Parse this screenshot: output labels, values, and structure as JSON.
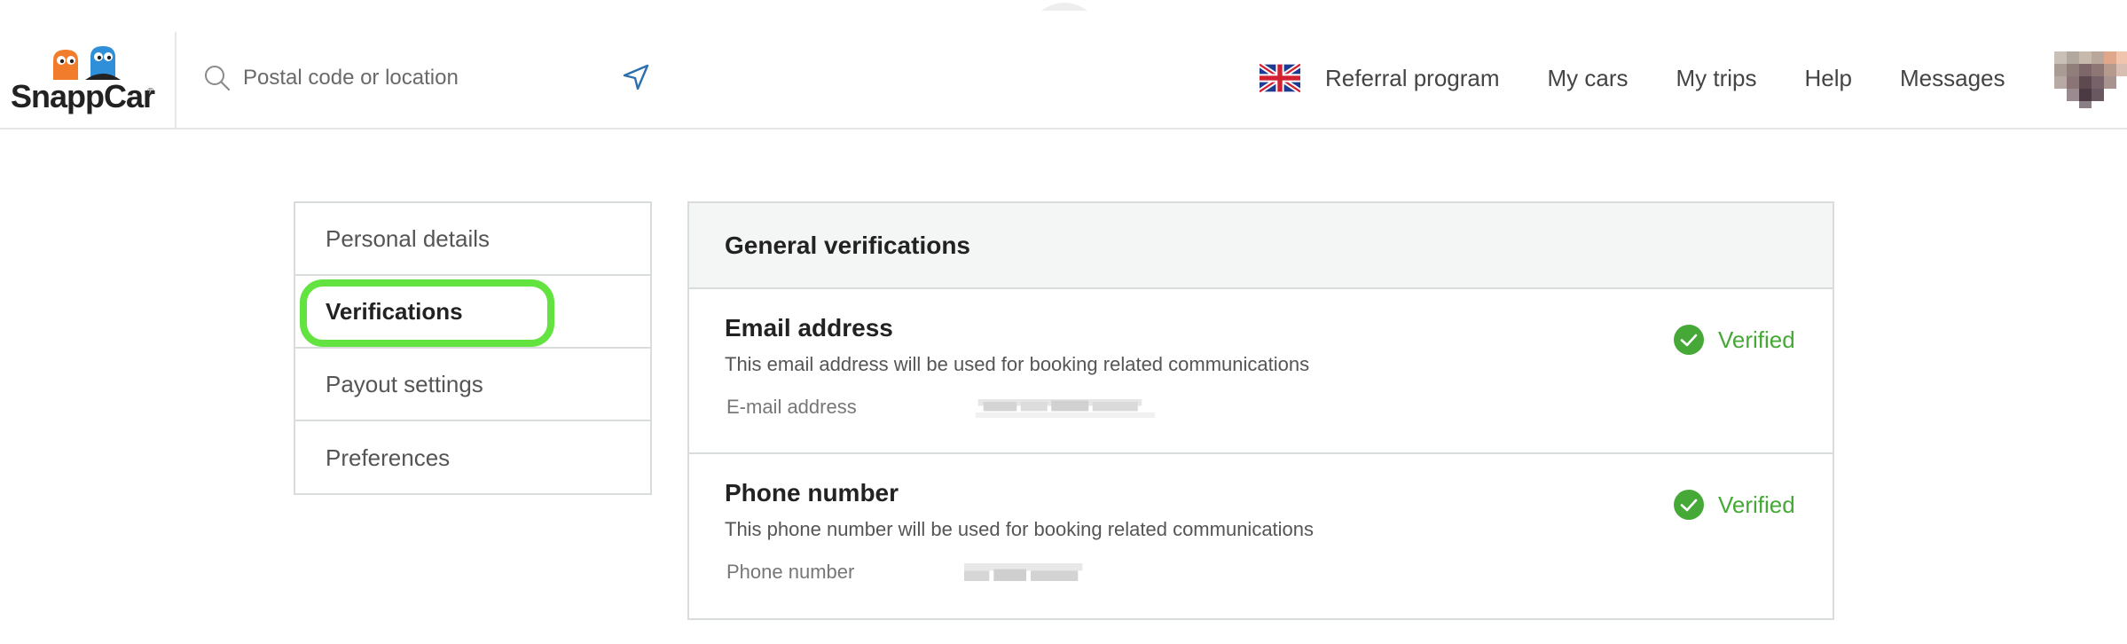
{
  "header": {
    "logo_text": "SnappCar",
    "search_placeholder": "Postal code or location",
    "nav": {
      "referral": "Referral program",
      "my_cars": "My cars",
      "my_trips": "My trips",
      "help": "Help",
      "messages": "Messages"
    },
    "language_icon": "uk-flag-icon"
  },
  "sidebar": {
    "items": [
      {
        "label": "Personal details"
      },
      {
        "label": "Verifications",
        "active": true
      },
      {
        "label": "Payout settings"
      },
      {
        "label": "Preferences"
      }
    ]
  },
  "panel": {
    "title": "General verifications",
    "email": {
      "title": "Email address",
      "description": "This email address will be used for booking related communications",
      "field_label": "E-mail address",
      "status": "Verified"
    },
    "phone": {
      "title": "Phone number",
      "description": "This phone number will be used for booking related communications",
      "field_label": "Phone number",
      "status": "Verified"
    }
  },
  "colors": {
    "verified_green": "#46a937",
    "highlight_green": "#63e33f",
    "border": "#d8dcdc",
    "panel_header_bg": "#f4f6f5"
  }
}
